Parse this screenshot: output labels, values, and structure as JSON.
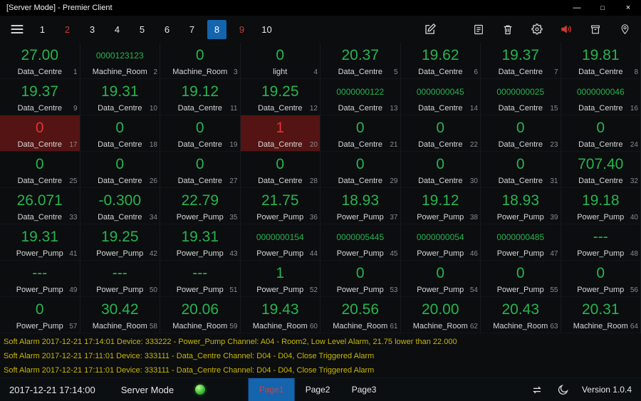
{
  "titlebar": {
    "title": "[Server Mode] - Premier Client",
    "controls": [
      {
        "name": "minimize",
        "glyph": "—"
      },
      {
        "name": "maximize",
        "glyph": "□"
      },
      {
        "name": "close",
        "glyph": "×"
      }
    ]
  },
  "toolbar": {
    "menu_icon": "menu-icon",
    "pages": [
      {
        "label": "1",
        "state": "normal"
      },
      {
        "label": "2",
        "state": "alarm"
      },
      {
        "label": "3",
        "state": "normal"
      },
      {
        "label": "4",
        "state": "normal"
      },
      {
        "label": "5",
        "state": "normal"
      },
      {
        "label": "6",
        "state": "normal"
      },
      {
        "label": "7",
        "state": "normal"
      },
      {
        "label": "8",
        "state": "active"
      },
      {
        "label": "9",
        "state": "alarm"
      },
      {
        "label": "10",
        "state": "normal"
      }
    ],
    "icons": [
      "edit-icon",
      "report-icon",
      "trash-icon",
      "settings-icon",
      "speaker-icon",
      "archive-icon",
      "location-icon"
    ]
  },
  "grid": {
    "cells": [
      {
        "index": 1,
        "value": "27.00",
        "label": "Data_Centre"
      },
      {
        "index": 2,
        "value": "0000123123",
        "label": "Machine_Room",
        "size": "small"
      },
      {
        "index": 3,
        "value": "0",
        "label": "Machine_Room"
      },
      {
        "index": 4,
        "value": "0",
        "label": "light"
      },
      {
        "index": 5,
        "value": "20.37",
        "label": "Data_Centre"
      },
      {
        "index": 6,
        "value": "19.62",
        "label": "Data_Centre"
      },
      {
        "index": 7,
        "value": "19.37",
        "label": "Data_Centre"
      },
      {
        "index": 8,
        "value": "19.81",
        "label": "Data_Centre"
      },
      {
        "index": 9,
        "value": "19.37",
        "label": "Data_Centre"
      },
      {
        "index": 10,
        "value": "19.31",
        "label": "Data_Centre"
      },
      {
        "index": 11,
        "value": "19.12",
        "label": "Data_Centre"
      },
      {
        "index": 12,
        "value": "19.25",
        "label": "Data_Centre"
      },
      {
        "index": 13,
        "value": "0000000122",
        "label": "Data_Centre",
        "size": "small"
      },
      {
        "index": 14,
        "value": "0000000045",
        "label": "Data_Centre",
        "size": "small"
      },
      {
        "index": 15,
        "value": "0000000025",
        "label": "Data_Centre",
        "size": "small"
      },
      {
        "index": 16,
        "value": "0000000046",
        "label": "Data_Centre",
        "size": "small"
      },
      {
        "index": 17,
        "value": "0",
        "label": "Data_Centre",
        "state": "alarm"
      },
      {
        "index": 18,
        "value": "0",
        "label": "Data_Centre"
      },
      {
        "index": 19,
        "value": "0",
        "label": "Data_Centre"
      },
      {
        "index": 20,
        "value": "1",
        "label": "Data_Centre",
        "state": "alarm"
      },
      {
        "index": 21,
        "value": "0",
        "label": "Data_Centre"
      },
      {
        "index": 22,
        "value": "0",
        "label": "Data_Centre"
      },
      {
        "index": 23,
        "value": "0",
        "label": "Data_Centre"
      },
      {
        "index": 24,
        "value": "0",
        "label": "Data_Centre"
      },
      {
        "index": 25,
        "value": "0",
        "label": "Data_Centre"
      },
      {
        "index": 26,
        "value": "0",
        "label": "Data_Centre"
      },
      {
        "index": 27,
        "value": "0",
        "label": "Data_Centre"
      },
      {
        "index": 28,
        "value": "0",
        "label": "Data_Centre"
      },
      {
        "index": 29,
        "value": "0",
        "label": "Data_Centre"
      },
      {
        "index": 30,
        "value": "0",
        "label": "Data_Centre"
      },
      {
        "index": 31,
        "value": "0",
        "label": "Data_Centre"
      },
      {
        "index": 32,
        "value": "707.40",
        "label": "Data_Centre"
      },
      {
        "index": 33,
        "value": "26.071",
        "label": "Data_Centre"
      },
      {
        "index": 34,
        "value": "-0.300",
        "label": "Data_Centre"
      },
      {
        "index": 35,
        "value": "22.79",
        "label": "Power_Pump"
      },
      {
        "index": 36,
        "value": "21.75",
        "label": "Power_Pump"
      },
      {
        "index": 37,
        "value": "18.93",
        "label": "Power_Pump"
      },
      {
        "index": 38,
        "value": "19.12",
        "label": "Power_Pump"
      },
      {
        "index": 39,
        "value": "18.93",
        "label": "Power_Pump"
      },
      {
        "index": 40,
        "value": "19.18",
        "label": "Power_Pump"
      },
      {
        "index": 41,
        "value": "19.31",
        "label": "Power_Pump"
      },
      {
        "index": 42,
        "value": "19.25",
        "label": "Power_Pump"
      },
      {
        "index": 43,
        "value": "19.31",
        "label": "Power_Pump"
      },
      {
        "index": 44,
        "value": "0000000154",
        "label": "Power_Pump",
        "size": "small"
      },
      {
        "index": 45,
        "value": "0000005445",
        "label": "Power_Pump",
        "size": "small"
      },
      {
        "index": 46,
        "value": "0000000054",
        "label": "Power_Pump",
        "size": "small"
      },
      {
        "index": 47,
        "value": "0000000485",
        "label": "Power_Pump",
        "size": "small"
      },
      {
        "index": 48,
        "value": "---",
        "label": "Power_Pump"
      },
      {
        "index": 49,
        "value": "---",
        "label": "Power_Pump"
      },
      {
        "index": 50,
        "value": "---",
        "label": "Power_Pump"
      },
      {
        "index": 51,
        "value": "---",
        "label": "Power_Pump"
      },
      {
        "index": 52,
        "value": "1",
        "label": "Power_Pump"
      },
      {
        "index": 53,
        "value": "0",
        "label": "Power_Pump"
      },
      {
        "index": 54,
        "value": "0",
        "label": "Power_Pump"
      },
      {
        "index": 55,
        "value": "0",
        "label": "Power_Pump"
      },
      {
        "index": 56,
        "value": "0",
        "label": "Power_Pump"
      },
      {
        "index": 57,
        "value": "0",
        "label": "Power_Pump"
      },
      {
        "index": 58,
        "value": "30.42",
        "label": "Machine_Room"
      },
      {
        "index": 59,
        "value": "20.06",
        "label": "Machine_Room"
      },
      {
        "index": 60,
        "value": "19.43",
        "label": "Machine_Room"
      },
      {
        "index": 61,
        "value": "20.56",
        "label": "Machine_Room"
      },
      {
        "index": 62,
        "value": "20.00",
        "label": "Machine_Room"
      },
      {
        "index": 63,
        "value": "20.43",
        "label": "Machine_Room"
      },
      {
        "index": 64,
        "value": "20.31",
        "label": "Machine_Room"
      }
    ]
  },
  "alarm_log": [
    "Soft Alarm 2017-12-21 17:14:01 Device: 333222 - Power_Pump Channel: A04 - Room2, Low Level Alarm, 21.75 lower than 22.000",
    "Soft Alarm 2017-12-21 17:11:01 Device: 333111 - Data_Centre Channel: D04 - D04, Close Triggered Alarm",
    "Soft Alarm 2017-12-21 17:11:01 Device: 333111 - Data_Centre Channel: D04 - D04, Close Triggered Alarm"
  ],
  "statusbar": {
    "datetime": "2017-12-21 17:14:00",
    "mode_label": "Server Mode",
    "tabs": [
      {
        "label": "Page1",
        "active": true
      },
      {
        "label": "Page2",
        "active": false
      },
      {
        "label": "Page3",
        "active": false
      }
    ],
    "icons": [
      "sync-icon",
      "moon-icon"
    ],
    "version": "Version 1.0.4"
  },
  "colors": {
    "value_green": "#26b44f",
    "alarm_red_text": "#df3531",
    "alarm_red_bg": "#541413",
    "accent_blue": "#1464ae",
    "alarm_log_yellow": "#c9b703",
    "page_alarm_red": "#cd3a37",
    "tab_active_text": "#cf4340"
  }
}
